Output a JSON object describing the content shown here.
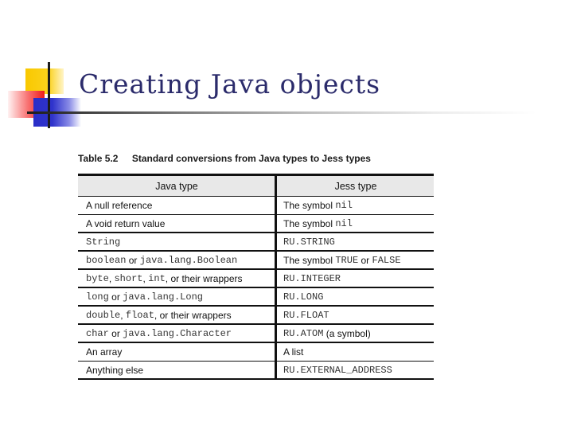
{
  "slide": {
    "title": "Creating Java objects"
  },
  "table": {
    "caption_number": "Table 5.2",
    "caption_text": "Standard conversions from Java types to Jess types",
    "headers": [
      "Java type",
      "Jess type"
    ],
    "rows": [
      {
        "java": [
          {
            "t": "A null reference",
            "code": false
          }
        ],
        "jess": [
          {
            "t": "The symbol ",
            "code": false
          },
          {
            "t": "nil",
            "code": true
          }
        ]
      },
      {
        "java": [
          {
            "t": "A void return value",
            "code": false
          }
        ],
        "jess": [
          {
            "t": "The symbol ",
            "code": false
          },
          {
            "t": "nil",
            "code": true
          }
        ]
      },
      {
        "java": [
          {
            "t": "String",
            "code": true
          }
        ],
        "jess": [
          {
            "t": "RU.STRING",
            "code": true
          }
        ]
      },
      {
        "java": [
          {
            "t": "boolean",
            "code": true
          },
          {
            "t": " or ",
            "code": false
          },
          {
            "t": "java.lang.Boolean",
            "code": true
          }
        ],
        "jess": [
          {
            "t": "The symbol ",
            "code": false
          },
          {
            "t": "TRUE",
            "code": true
          },
          {
            "t": " or ",
            "code": false
          },
          {
            "t": "FALSE",
            "code": true
          }
        ]
      },
      {
        "java": [
          {
            "t": "byte",
            "code": true
          },
          {
            "t": ", ",
            "code": false
          },
          {
            "t": "short",
            "code": true
          },
          {
            "t": ", ",
            "code": false
          },
          {
            "t": "int",
            "code": true
          },
          {
            "t": ", or their wrappers",
            "code": false
          }
        ],
        "jess": [
          {
            "t": "RU.INTEGER",
            "code": true
          }
        ]
      },
      {
        "java": [
          {
            "t": "long",
            "code": true
          },
          {
            "t": " or ",
            "code": false
          },
          {
            "t": "java.lang.Long",
            "code": true
          }
        ],
        "jess": [
          {
            "t": "RU.LONG",
            "code": true
          }
        ]
      },
      {
        "java": [
          {
            "t": "double",
            "code": true
          },
          {
            "t": ", ",
            "code": false
          },
          {
            "t": "float",
            "code": true
          },
          {
            "t": ", or their wrappers",
            "code": false
          }
        ],
        "jess": [
          {
            "t": "RU.FLOAT",
            "code": true
          }
        ]
      },
      {
        "java": [
          {
            "t": "char",
            "code": true
          },
          {
            "t": " or ",
            "code": false
          },
          {
            "t": "java.lang.Character",
            "code": true
          }
        ],
        "jess": [
          {
            "t": "RU.ATOM",
            "code": true
          },
          {
            "t": " (a symbol)",
            "code": false
          }
        ]
      },
      {
        "java": [
          {
            "t": "An array",
            "code": false
          }
        ],
        "jess": [
          {
            "t": "A list",
            "code": false
          }
        ]
      },
      {
        "java": [
          {
            "t": "Anything else",
            "code": false
          }
        ],
        "jess": [
          {
            "t": "RU.EXTERNAL_ADDRESS",
            "code": true
          }
        ]
      }
    ],
    "thick_after_rows": [
      1,
      2,
      3,
      4,
      5,
      6,
      7,
      9
    ]
  },
  "colors": {
    "title": "#2b2b6b",
    "header_bg": "#e8e8e8"
  }
}
